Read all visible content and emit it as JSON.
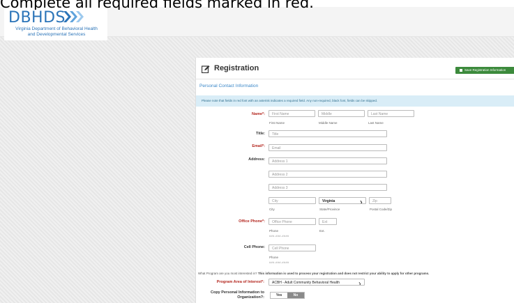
{
  "banner_text": "Complete all required fields marked in red.",
  "logo": {
    "name": "DBHDS",
    "subtitle_line1": "Virginia Department of Behavioral Health",
    "subtitle_line2": "and Developmental Services"
  },
  "panel": {
    "title": "Registration",
    "save_label": "Save Registration Information",
    "section_title": "Personal Contact Information",
    "note": "Please note that fields in red font with an asterisk indicates a required field. Any non-required, black font, fields can be skipped."
  },
  "form": {
    "name": {
      "label": "Name*:",
      "first_placeholder": "First Name",
      "middle_placeholder": "Middle",
      "last_placeholder": "Last Name",
      "first_hint": "First Name",
      "middle_hint": "Middle Name",
      "last_hint": "Last Name"
    },
    "title": {
      "label": "Title:",
      "placeholder": "Title"
    },
    "email": {
      "label": "Email*:",
      "placeholder": "Email"
    },
    "address": {
      "label": "Address:",
      "line1_placeholder": "Address 1",
      "line2_placeholder": "Address 2",
      "line3_placeholder": "Address 3",
      "city_placeholder": "City",
      "state_value": "Virginia",
      "zip_placeholder": "Zip",
      "city_hint": "City",
      "state_hint": "State/Province",
      "zip_hint": "Postal Code/Zip"
    },
    "office_phone": {
      "label": "Office Phone*:",
      "placeholder": "Office Phone",
      "ext_placeholder": "Ext",
      "phone_hint": "Phone",
      "ext_hint": "Ext.",
      "mask": "###-###-####"
    },
    "cell_phone": {
      "label": "Cell Phone:",
      "placeholder": "Cell Phone",
      "phone_hint": "Phone",
      "mask": "###-###-####"
    },
    "program_question": "What Program are you most interested in?",
    "program_question_bold": "This information is used to process your registration and does not restrict your ability to apply for other programs.",
    "program": {
      "label": "Program Area of Interest*:",
      "value": "ACBH - Adult Community Behavioral Health"
    },
    "copy_info": {
      "label_line1": "Copy Personal Information to",
      "label_line2": "Organization?:",
      "yes": "Yes",
      "no": "No",
      "selected": "No"
    }
  },
  "colors": {
    "accent": "#3a87c8",
    "required": "#b3261e",
    "save_button": "#3c8a3c",
    "note_bg": "#d9edf7"
  }
}
